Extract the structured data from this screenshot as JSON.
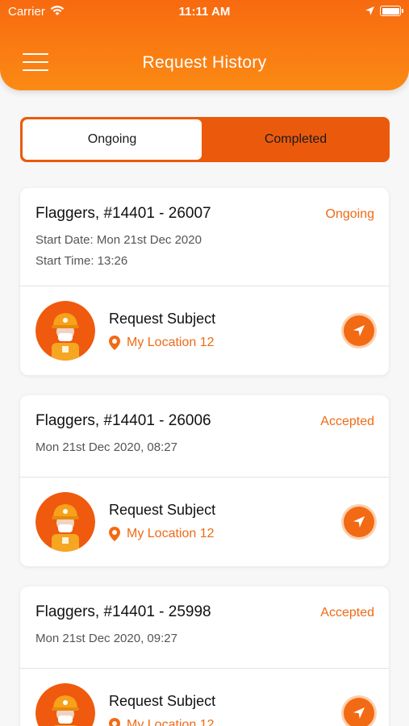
{
  "status_bar": {
    "carrier": "Carrier",
    "time": "11:11 AM"
  },
  "header": {
    "title": "Request History",
    "menu_icon": "hamburger-menu-icon"
  },
  "tabs": [
    {
      "label": "Ongoing",
      "selected": true
    },
    {
      "label": "Completed",
      "selected": false
    }
  ],
  "requests": [
    {
      "title": "Flaggers, #14401 - 26007",
      "status": "Ongoing",
      "line1": "Start Date: Mon 21st Dec 2020",
      "line2": "Start Time: 13:26",
      "subject": "Request Subject",
      "location": "My Location 12"
    },
    {
      "title": "Flaggers, #14401 - 26006",
      "status": "Accepted",
      "line1": "Mon 21st Dec 2020, 08:27",
      "subject": "Request Subject",
      "location": "My Location 12"
    },
    {
      "title": "Flaggers, #14401 - 25998",
      "status": "Accepted",
      "line1": "Mon 21st Dec 2020, 09:27",
      "subject": "Request Subject",
      "location": "My Location 12"
    }
  ],
  "colors": {
    "accent": "#f26a14",
    "header_gradient_top": "#f86a10",
    "header_gradient_bottom": "#fb8a14",
    "segment_bg": "#eb5a0c"
  }
}
